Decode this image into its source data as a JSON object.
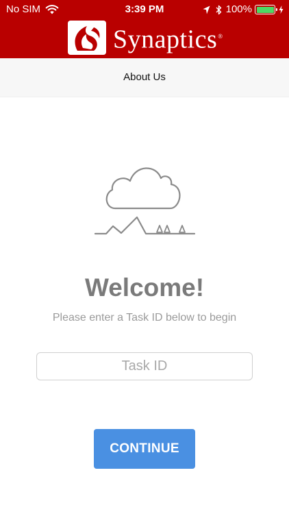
{
  "status_bar": {
    "carrier": "No SIM",
    "time": "3:39 PM",
    "battery_percent": "100%",
    "battery_level": 1.0,
    "icons": [
      "wifi-icon",
      "location-arrow-icon",
      "bluetooth-icon",
      "battery-icon",
      "charging-bolt-icon"
    ]
  },
  "header": {
    "brand_name": "Synaptics",
    "brand_mark": "®",
    "logo_icon": "synaptics-leaf-logo",
    "background_color": "#b90000"
  },
  "nav": {
    "about_label": "About Us"
  },
  "main": {
    "illustration_icon": "cloud-mountains-trees-icon",
    "welcome_title": "Welcome!",
    "subtitle": "Please enter a Task ID below to begin",
    "task_id_placeholder": "Task ID",
    "task_id_value": "",
    "continue_label": "CONTINUE",
    "accent_color": "#4a90e2"
  }
}
